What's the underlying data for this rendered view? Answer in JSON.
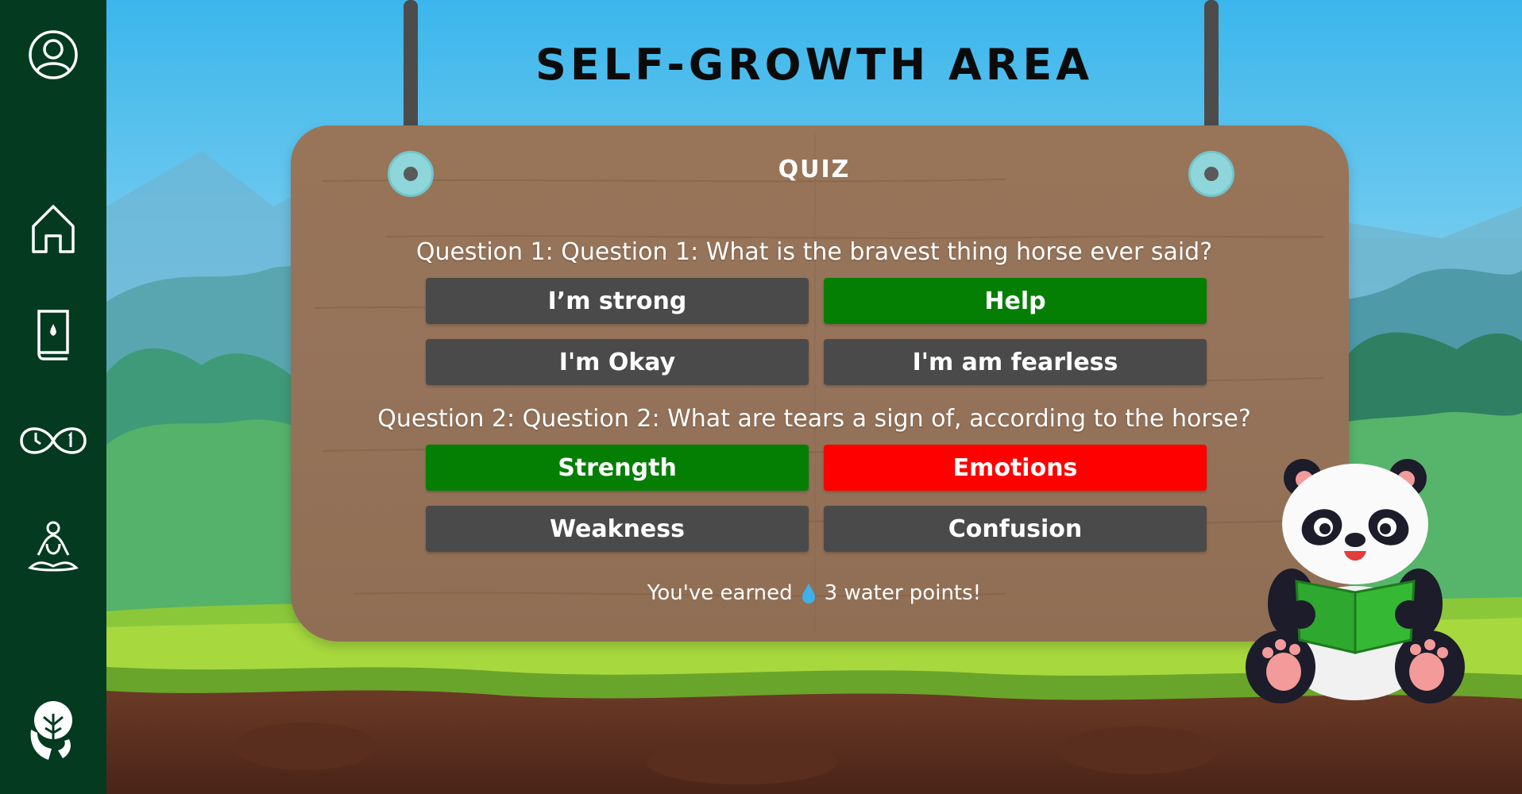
{
  "page": {
    "title": "SELF-GROWTH AREA"
  },
  "sidebar": {
    "items": [
      {
        "icon": "user-profile-icon"
      },
      {
        "icon": "home-icon"
      },
      {
        "icon": "book-water-icon"
      },
      {
        "icon": "infinity-clock-icon"
      },
      {
        "icon": "meditation-icon"
      },
      {
        "icon": "tree-head-logo-icon"
      }
    ]
  },
  "quiz": {
    "label": "QUIZ",
    "questions": [
      {
        "text": "Question 1: Question 1: What is the bravest thing horse ever said?",
        "answers": [
          {
            "label": "I’m strong",
            "state": "neutral"
          },
          {
            "label": "Help",
            "state": "correct"
          },
          {
            "label": "I'm Okay",
            "state": "neutral"
          },
          {
            "label": "I'm am fearless",
            "state": "neutral"
          }
        ]
      },
      {
        "text": "Question 2: Question 2: What are tears a sign of, according to the horse?",
        "answers": [
          {
            "label": "Strength",
            "state": "correct"
          },
          {
            "label": "Emotions",
            "state": "wrong"
          },
          {
            "label": "Weakness",
            "state": "neutral"
          },
          {
            "label": "Confusion",
            "state": "neutral"
          }
        ]
      }
    ],
    "earned": {
      "prefix": "You've earned",
      "icon": "water-drop-icon",
      "suffix": "3 water points!"
    }
  },
  "colors": {
    "sidebar": "#043a20",
    "correct": "#047f04",
    "wrong": "#fe0000",
    "neutral": "#4a4a4a",
    "board": "#987558"
  }
}
